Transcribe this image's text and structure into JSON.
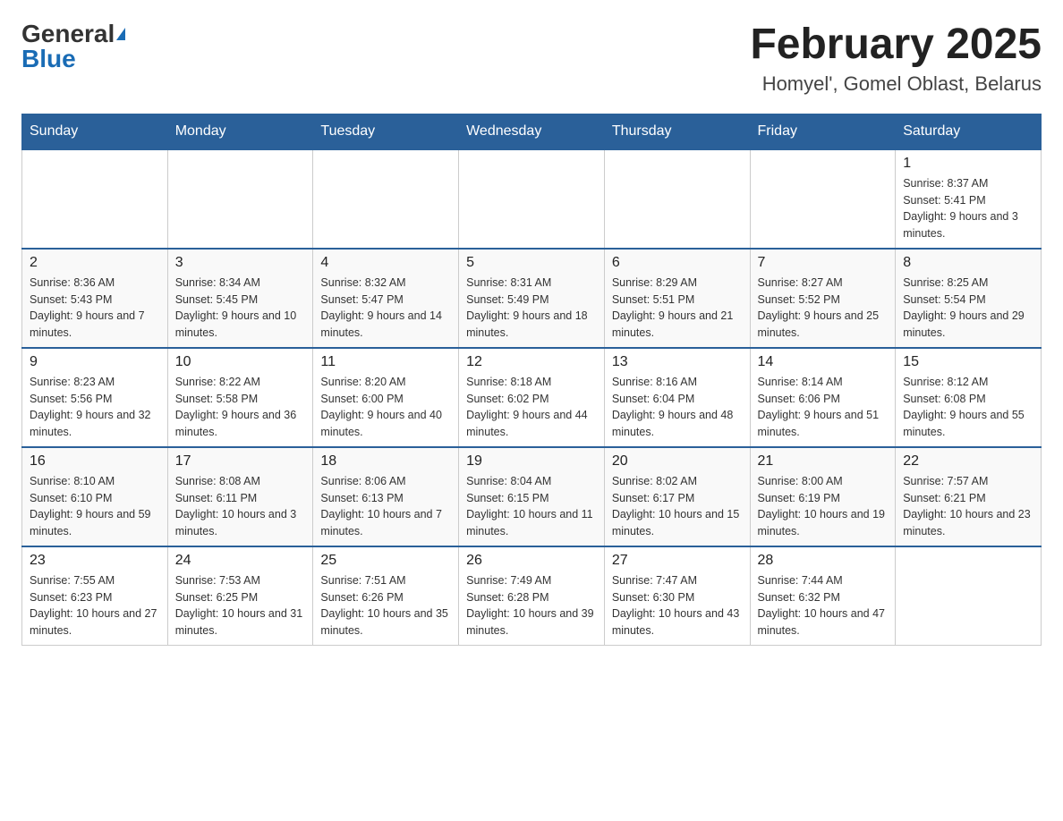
{
  "header": {
    "logo_general": "General",
    "logo_blue": "Blue",
    "title": "February 2025",
    "subtitle": "Homyel', Gomel Oblast, Belarus"
  },
  "days_of_week": [
    "Sunday",
    "Monday",
    "Tuesday",
    "Wednesday",
    "Thursday",
    "Friday",
    "Saturday"
  ],
  "weeks": [
    [
      {
        "day": "",
        "sunrise": "",
        "sunset": "",
        "daylight": ""
      },
      {
        "day": "",
        "sunrise": "",
        "sunset": "",
        "daylight": ""
      },
      {
        "day": "",
        "sunrise": "",
        "sunset": "",
        "daylight": ""
      },
      {
        "day": "",
        "sunrise": "",
        "sunset": "",
        "daylight": ""
      },
      {
        "day": "",
        "sunrise": "",
        "sunset": "",
        "daylight": ""
      },
      {
        "day": "",
        "sunrise": "",
        "sunset": "",
        "daylight": ""
      },
      {
        "day": "1",
        "sunrise": "Sunrise: 8:37 AM",
        "sunset": "Sunset: 5:41 PM",
        "daylight": "Daylight: 9 hours and 3 minutes."
      }
    ],
    [
      {
        "day": "2",
        "sunrise": "Sunrise: 8:36 AM",
        "sunset": "Sunset: 5:43 PM",
        "daylight": "Daylight: 9 hours and 7 minutes."
      },
      {
        "day": "3",
        "sunrise": "Sunrise: 8:34 AM",
        "sunset": "Sunset: 5:45 PM",
        "daylight": "Daylight: 9 hours and 10 minutes."
      },
      {
        "day": "4",
        "sunrise": "Sunrise: 8:32 AM",
        "sunset": "Sunset: 5:47 PM",
        "daylight": "Daylight: 9 hours and 14 minutes."
      },
      {
        "day": "5",
        "sunrise": "Sunrise: 8:31 AM",
        "sunset": "Sunset: 5:49 PM",
        "daylight": "Daylight: 9 hours and 18 minutes."
      },
      {
        "day": "6",
        "sunrise": "Sunrise: 8:29 AM",
        "sunset": "Sunset: 5:51 PM",
        "daylight": "Daylight: 9 hours and 21 minutes."
      },
      {
        "day": "7",
        "sunrise": "Sunrise: 8:27 AM",
        "sunset": "Sunset: 5:52 PM",
        "daylight": "Daylight: 9 hours and 25 minutes."
      },
      {
        "day": "8",
        "sunrise": "Sunrise: 8:25 AM",
        "sunset": "Sunset: 5:54 PM",
        "daylight": "Daylight: 9 hours and 29 minutes."
      }
    ],
    [
      {
        "day": "9",
        "sunrise": "Sunrise: 8:23 AM",
        "sunset": "Sunset: 5:56 PM",
        "daylight": "Daylight: 9 hours and 32 minutes."
      },
      {
        "day": "10",
        "sunrise": "Sunrise: 8:22 AM",
        "sunset": "Sunset: 5:58 PM",
        "daylight": "Daylight: 9 hours and 36 minutes."
      },
      {
        "day": "11",
        "sunrise": "Sunrise: 8:20 AM",
        "sunset": "Sunset: 6:00 PM",
        "daylight": "Daylight: 9 hours and 40 minutes."
      },
      {
        "day": "12",
        "sunrise": "Sunrise: 8:18 AM",
        "sunset": "Sunset: 6:02 PM",
        "daylight": "Daylight: 9 hours and 44 minutes."
      },
      {
        "day": "13",
        "sunrise": "Sunrise: 8:16 AM",
        "sunset": "Sunset: 6:04 PM",
        "daylight": "Daylight: 9 hours and 48 minutes."
      },
      {
        "day": "14",
        "sunrise": "Sunrise: 8:14 AM",
        "sunset": "Sunset: 6:06 PM",
        "daylight": "Daylight: 9 hours and 51 minutes."
      },
      {
        "day": "15",
        "sunrise": "Sunrise: 8:12 AM",
        "sunset": "Sunset: 6:08 PM",
        "daylight": "Daylight: 9 hours and 55 minutes."
      }
    ],
    [
      {
        "day": "16",
        "sunrise": "Sunrise: 8:10 AM",
        "sunset": "Sunset: 6:10 PM",
        "daylight": "Daylight: 9 hours and 59 minutes."
      },
      {
        "day": "17",
        "sunrise": "Sunrise: 8:08 AM",
        "sunset": "Sunset: 6:11 PM",
        "daylight": "Daylight: 10 hours and 3 minutes."
      },
      {
        "day": "18",
        "sunrise": "Sunrise: 8:06 AM",
        "sunset": "Sunset: 6:13 PM",
        "daylight": "Daylight: 10 hours and 7 minutes."
      },
      {
        "day": "19",
        "sunrise": "Sunrise: 8:04 AM",
        "sunset": "Sunset: 6:15 PM",
        "daylight": "Daylight: 10 hours and 11 minutes."
      },
      {
        "day": "20",
        "sunrise": "Sunrise: 8:02 AM",
        "sunset": "Sunset: 6:17 PM",
        "daylight": "Daylight: 10 hours and 15 minutes."
      },
      {
        "day": "21",
        "sunrise": "Sunrise: 8:00 AM",
        "sunset": "Sunset: 6:19 PM",
        "daylight": "Daylight: 10 hours and 19 minutes."
      },
      {
        "day": "22",
        "sunrise": "Sunrise: 7:57 AM",
        "sunset": "Sunset: 6:21 PM",
        "daylight": "Daylight: 10 hours and 23 minutes."
      }
    ],
    [
      {
        "day": "23",
        "sunrise": "Sunrise: 7:55 AM",
        "sunset": "Sunset: 6:23 PM",
        "daylight": "Daylight: 10 hours and 27 minutes."
      },
      {
        "day": "24",
        "sunrise": "Sunrise: 7:53 AM",
        "sunset": "Sunset: 6:25 PM",
        "daylight": "Daylight: 10 hours and 31 minutes."
      },
      {
        "day": "25",
        "sunrise": "Sunrise: 7:51 AM",
        "sunset": "Sunset: 6:26 PM",
        "daylight": "Daylight: 10 hours and 35 minutes."
      },
      {
        "day": "26",
        "sunrise": "Sunrise: 7:49 AM",
        "sunset": "Sunset: 6:28 PM",
        "daylight": "Daylight: 10 hours and 39 minutes."
      },
      {
        "day": "27",
        "sunrise": "Sunrise: 7:47 AM",
        "sunset": "Sunset: 6:30 PM",
        "daylight": "Daylight: 10 hours and 43 minutes."
      },
      {
        "day": "28",
        "sunrise": "Sunrise: 7:44 AM",
        "sunset": "Sunset: 6:32 PM",
        "daylight": "Daylight: 10 hours and 47 minutes."
      },
      {
        "day": "",
        "sunrise": "",
        "sunset": "",
        "daylight": ""
      }
    ]
  ]
}
